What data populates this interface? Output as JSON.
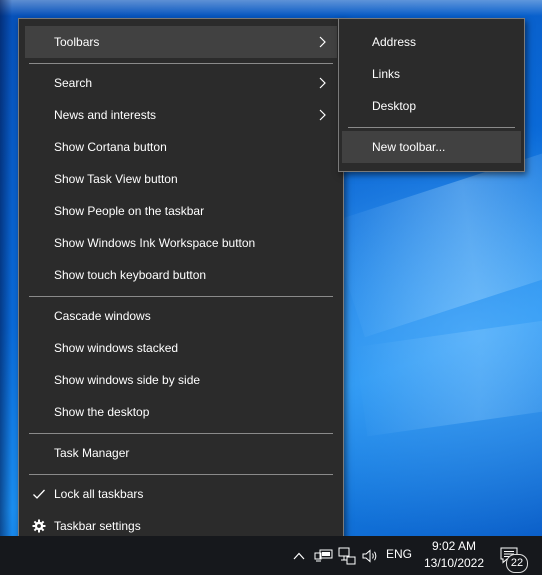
{
  "context_menu": {
    "items": [
      {
        "label": "Toolbars",
        "submenu": true
      },
      {
        "label": "Search",
        "submenu": true
      },
      {
        "label": "News and interests",
        "submenu": true
      },
      {
        "label": "Show Cortana button"
      },
      {
        "label": "Show Task View button"
      },
      {
        "label": "Show People on the taskbar"
      },
      {
        "label": "Show Windows Ink Workspace button"
      },
      {
        "label": "Show touch keyboard button"
      },
      {
        "label": "Cascade windows"
      },
      {
        "label": "Show windows stacked"
      },
      {
        "label": "Show windows side by side"
      },
      {
        "label": "Show the desktop"
      },
      {
        "label": "Task Manager"
      },
      {
        "label": "Lock all taskbars",
        "checked": true
      },
      {
        "label": "Taskbar settings",
        "icon": "gear-icon"
      }
    ]
  },
  "toolbars_submenu": {
    "items": [
      {
        "label": "Address"
      },
      {
        "label": "Links"
      },
      {
        "label": "Desktop"
      },
      {
        "label": "New toolbar..."
      }
    ]
  },
  "taskbar": {
    "language": "ENG",
    "time": "9:02 AM",
    "date": "13/10/2022",
    "notification_count": "22",
    "icons": [
      "chevron-up-icon",
      "battery-icon",
      "network-icon",
      "volume-icon",
      "action-center-icon"
    ]
  },
  "colors": {
    "menu_bg": "#2b2b2b",
    "menu_hover": "#414141",
    "taskbar_bg": "#16181c",
    "desktop_blue": "#0a63c7"
  }
}
